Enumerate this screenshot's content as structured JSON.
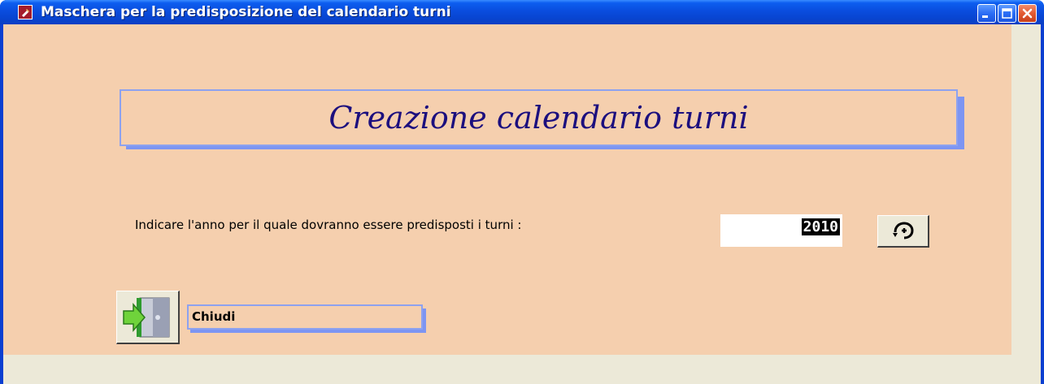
{
  "window": {
    "title": "Maschera per la predisposizione del calendario turni",
    "controls": {
      "minimize_icon": "minimize-icon",
      "maximize_icon": "maximize-icon",
      "close_icon": "close-icon"
    }
  },
  "form": {
    "header_title": "Creazione calendario turni",
    "prompt_label": "Indicare l'anno per il quale dovranno essere predisposti i turni :",
    "year_value": "2010",
    "run_button_icon": "run-macro-icon",
    "close_button_icon": "exit-door-icon",
    "close_label": "Chiudi"
  },
  "colors": {
    "form_background": "#f5cfae",
    "window_background": "#ece9d8",
    "titlebar_blue": "#0a4fe0",
    "banner_border": "#8da2ef",
    "banner_shadow": "#7d95f2",
    "header_text": "#1c0f7e"
  }
}
